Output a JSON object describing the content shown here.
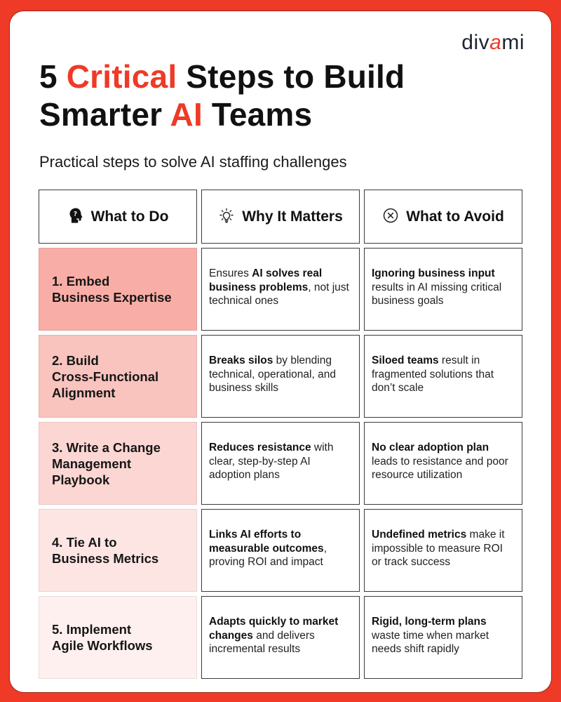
{
  "brand": {
    "logo_pre": "div",
    "logo_accent": "a",
    "logo_post": "mi",
    "accent_color": "#ee3a26"
  },
  "header": {
    "title_parts": [
      "5 ",
      "Critical",
      " Steps to Build",
      "Smarter ",
      "AI",
      " Teams"
    ],
    "subtitle": "Practical steps to solve AI staffing challenges"
  },
  "table": {
    "columns": [
      {
        "label": "What to Do",
        "icon": "head-question-icon"
      },
      {
        "label": "Why It Matters",
        "icon": "lightbulb-icon"
      },
      {
        "label": "What to Avoid",
        "icon": "circle-x-icon"
      }
    ],
    "rows": [
      {
        "step": "1. Embed\nBusiness Expertise",
        "step_bg": "#f8aea6",
        "why_bold": "AI solves real business problems",
        "why_pre": "Ensures ",
        "why_post": ", not just technical ones",
        "avoid_bold": "Ignoring business input",
        "avoid_post": " results in AI missing critical business goals"
      },
      {
        "step": "2. Build\nCross-Functional\nAlignment",
        "step_bg": "#f9c3be",
        "why_pre": "",
        "why_bold": "Breaks silos",
        "why_post": " by blending technical, operational, and business skills",
        "avoid_bold": "Siloed teams",
        "avoid_post": " result in fragmented solutions that don’t scale"
      },
      {
        "step": "3. Write a Change\nManagement\nPlaybook",
        "step_bg": "#fcd6d3",
        "why_pre": "",
        "why_bold": "Reduces resistance",
        "why_post": " with clear, step-by-step AI adoption plans",
        "avoid_bold": "No clear adoption plan",
        "avoid_post": " leads to resistance and poor resource utilization"
      },
      {
        "step": "4. Tie AI to\nBusiness Metrics",
        "step_bg": "#fde5e3",
        "why_pre": "",
        "why_bold": "Links AI efforts to measurable outcomes",
        "why_post": ", proving ROI and impact",
        "avoid_bold": "Undefined metrics",
        "avoid_post": " make it impossible to measure ROI or track success"
      },
      {
        "step": "5. Implement\nAgile Workflows",
        "step_bg": "#fdf0ef",
        "why_pre": "",
        "why_bold": "Adapts quickly to market changes",
        "why_post": " and delivers incremental results",
        "avoid_bold": "Rigid, long-term plans",
        "avoid_post": " waste time when market needs shift rapidly"
      }
    ]
  }
}
